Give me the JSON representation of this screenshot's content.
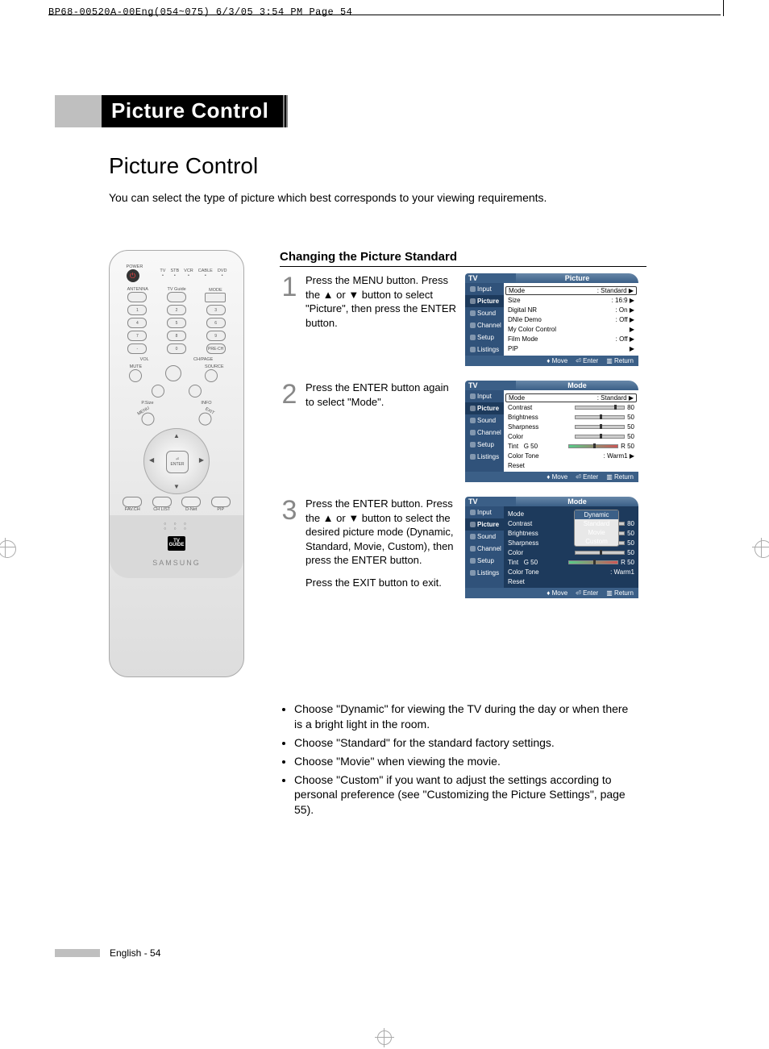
{
  "crop_mark": "BP68-00520A-00Eng(054~075)  6/3/05  3:54 PM  Page 54",
  "chapter_title": "Picture Control",
  "section_title": "Picture Control",
  "intro": "You can select the type of picture which best corresponds to your viewing requirements.",
  "subheading": "Changing the Picture Standard",
  "steps": {
    "s1": {
      "num": "1",
      "text": "Press the MENU button. Press the ▲ or ▼ button to select \"Picture\", then press the ENTER button."
    },
    "s2": {
      "num": "2",
      "text": "Press the ENTER button again to select \"Mode\"."
    },
    "s3": {
      "num": "3",
      "text": "Press the ENTER button. Press the ▲ or ▼ button to select the desired picture mode (Dynamic, Standard, Movie, Custom), then press the ENTER button."
    },
    "s3b": "Press the EXIT button to exit."
  },
  "osd": {
    "side": {
      "input": "Input",
      "picture": "Picture",
      "sound": "Sound",
      "channel": "Channel",
      "setup": "Setup",
      "listings": "Listings",
      "tv": "TV"
    },
    "foot": {
      "move": "Move",
      "enter": "Enter",
      "return": "Return"
    },
    "screen1": {
      "title": "Picture",
      "rows": {
        "mode_l": "Mode",
        "mode_v": ": Standard",
        "size_l": "Size",
        "size_v": ": 16:9",
        "dnr_l": "Digital NR",
        "dnr_v": ": On",
        "dnie_l": "DNIe Demo",
        "dnie_v": ": Off",
        "mcc_l": "My Color Control",
        "film_l": "Film Mode",
        "film_v": ": Off",
        "pip_l": "PIP"
      }
    },
    "screen2": {
      "title": "Mode",
      "rows": {
        "mode_l": "Mode",
        "mode_v": ": Standard",
        "cont_l": "Contrast",
        "cont_v": "80",
        "bri_l": "Brightness",
        "bri_v": "50",
        "sharp_l": "Sharpness",
        "sharp_v": "50",
        "col_l": "Color",
        "col_v": "50",
        "tint_l": "Tint",
        "tint_g": "G 50",
        "tint_r": "R 50",
        "tone_l": "Color Tone",
        "tone_v": ": Warm1",
        "reset_l": "Reset"
      }
    },
    "screen3": {
      "title": "Mode",
      "popup": {
        "dyn": "Dynamic",
        "std": "Standard",
        "mov": "Movie",
        "cus": "Custom"
      },
      "rows": {
        "mode_l": "Mode",
        "cont_l": "Contrast",
        "cont_v": "80",
        "bri_l": "Brightness",
        "bri_v": "50",
        "sharp_l": "Sharpness",
        "sharp_v": "50",
        "col_l": "Color",
        "col_v": "50",
        "tint_l": "Tint",
        "tint_g": "G 50",
        "tint_r": "R 50",
        "tone_l": "Color Tone",
        "tone_v": ": Warm1",
        "reset_l": "Reset"
      }
    }
  },
  "bullets": {
    "b1": "Choose \"Dynamic\" for viewing the TV during the day or when there is a bright light in the room.",
    "b2": "Choose \"Standard\" for the standard factory settings.",
    "b3": "Choose \"Movie\" when viewing the movie.",
    "b4": "Choose \"Custom\" if you want to adjust the settings according to personal preference (see \"Customizing the Picture Settings\", page 55)."
  },
  "footer": "English - 54",
  "remote": {
    "power": "POWER",
    "tv": "TV",
    "stb": "STB",
    "vcr": "VCR",
    "cable": "CABLE",
    "dvd": "DVD",
    "antenna": "ANTENNA",
    "tvguide": "TV Guide",
    "mode": "MODE",
    "n1": "1",
    "n2": "2",
    "n3": "3",
    "n4": "4",
    "n5": "5",
    "n6": "6",
    "n7": "7",
    "n8": "8",
    "n9": "9",
    "dash": "-",
    "n0": "0",
    "prech": "PRE-CH",
    "vol": "VOL",
    "chpage": "CH/PAGE",
    "mute": "MUTE",
    "source": "SOURCE",
    "psize": "P.Size",
    "info": "INFO",
    "menu": "MENU",
    "exit": "EXIT",
    "enter": "ENTER",
    "favch": "FAV.CH",
    "chlist": "CH LIST",
    "dnet": "D-Net",
    "pip": "PIP",
    "tvguide_big_t": "TV",
    "tvguide_big_b": "GUIDE",
    "brand": "SAMSUNG"
  }
}
